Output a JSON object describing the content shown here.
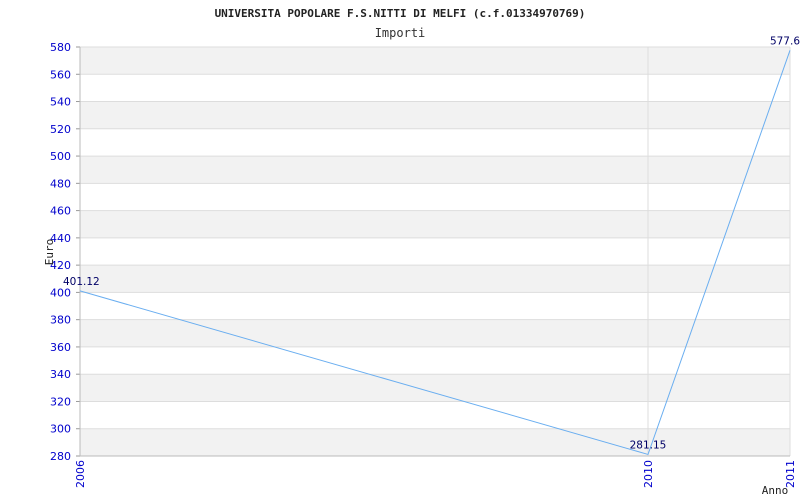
{
  "chart_data": {
    "type": "line",
    "title": "UNIVERSITA POPOLARE F.S.NITTI DI MELFI (c.f.01334970769)",
    "subtitle": "Importi",
    "xlabel": "Anno",
    "ylabel": "Euro",
    "x": [
      "2006",
      "2010",
      "2011"
    ],
    "series": [
      {
        "values": [
          401.12,
          281.15,
          577.6
        ],
        "labels": [
          "401.12",
          "281.15",
          "577.6"
        ]
      }
    ],
    "ylim": [
      280,
      580
    ],
    "yticks": [
      280,
      300,
      320,
      340,
      360,
      380,
      400,
      420,
      440,
      460,
      480,
      500,
      520,
      540,
      560,
      580
    ],
    "grid": true,
    "colors": {
      "line": "#6aaef0",
      "band": "#f2f2f2",
      "grid": "#dddddd",
      "tick_text": "#0000cc"
    }
  }
}
